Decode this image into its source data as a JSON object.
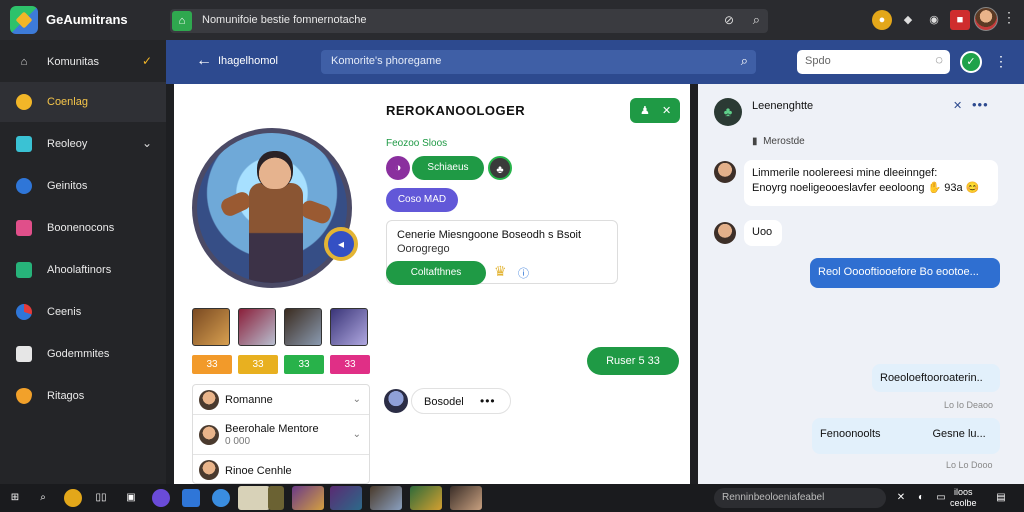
{
  "app": {
    "name": "GeAumitrans",
    "url": "Nomunifoie bestie fomnernotache"
  },
  "sidebar": {
    "items": [
      {
        "label": "Komunitas",
        "icon": "home-icon"
      },
      {
        "label": "Coenlag",
        "icon": "user-icon"
      },
      {
        "label": "Reoleoy",
        "icon": "monitor-icon"
      },
      {
        "label": "Geinitos",
        "icon": "compass-icon"
      },
      {
        "label": "Boonenocons",
        "icon": "mail-icon"
      },
      {
        "label": "Ahoolaftinors",
        "icon": "puzzle-icon"
      },
      {
        "label": "Ceenis",
        "icon": "chart-icon"
      },
      {
        "label": "Godemmites",
        "icon": "document-icon"
      },
      {
        "label": "Ritagos",
        "icon": "shield-icon"
      }
    ]
  },
  "header": {
    "title": "Ihagelhomol",
    "search_text": "Komorite's phoregame",
    "right_search_placeholder": "Spdo"
  },
  "profile": {
    "title": "REROKANOOLOGER",
    "top_button": "✕",
    "subheading": "Feozoo Sloos",
    "green_button": "Schiaeus",
    "violet_button": "Coso MAD",
    "info_line1": "Cenerie Miesngoone Boseodh  s Bsoit",
    "info_line2": "Oorogrego",
    "green_pill": "Coltafthnes",
    "send_button": "Ruser  5 33",
    "comment_text": "Bosodel",
    "items": [
      "",
      "",
      "",
      ""
    ],
    "item_pills": [
      "33",
      "33",
      "33",
      "33"
    ]
  },
  "friends": [
    {
      "name": "Romanne",
      "sub": ""
    },
    {
      "name": "Beerohale Mentore",
      "sub": "0 000"
    },
    {
      "name": "Rinoe Cenhle",
      "sub": ""
    }
  ],
  "chat": {
    "title": "Leenenghtte",
    "subtitle": "Merostde",
    "messages": [
      {
        "type": "in",
        "text": "Limmerile noolereesi mine dleeinngef:\nEnoyrg noeligeooeslavfer eeoloong ✋ 93a 😊"
      },
      {
        "type": "in",
        "text": "Uoo"
      },
      {
        "type": "out",
        "text": "Reol Ooooftiooefore Bo eootoe..."
      },
      {
        "type": "lite",
        "text": "Roeoloeftooroaterin..",
        "meta": "Lo  Io  Deaoo"
      },
      {
        "type": "lite",
        "text": "Fenoonoolts                 Gesne lu...",
        "meta": "Lo  Lo  Dooo"
      }
    ]
  },
  "taskbar": {
    "search_text": "Renninbeoloeniafeabel",
    "clock_line1": "iloos",
    "clock_line2": "ceolbe"
  }
}
